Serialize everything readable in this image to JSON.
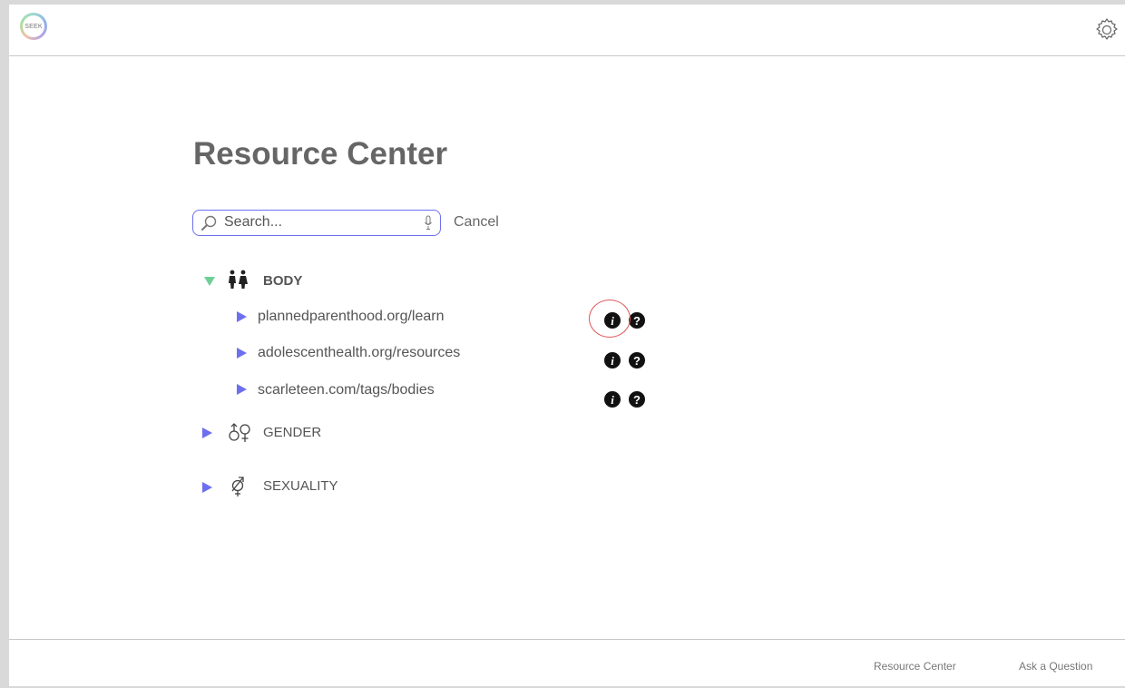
{
  "app": {
    "logo_text": "SEEK"
  },
  "page": {
    "title": "Resource Center"
  },
  "search": {
    "placeholder": "Search...",
    "value": "",
    "cancel_label": "Cancel"
  },
  "categories": [
    {
      "label": "BODY",
      "icon": "people-icon",
      "expanded": true,
      "links": [
        {
          "text": "plannedparenthood.org/learn"
        },
        {
          "text": "adolescenthealth.org/resources"
        },
        {
          "text": "scarleteen.com/tags/bodies"
        }
      ]
    },
    {
      "label": "GENDER",
      "icon": "gender-symbols-icon",
      "expanded": false
    },
    {
      "label": "SEXUALITY",
      "icon": "sexuality-symbol-icon",
      "expanded": false
    }
  ],
  "icons": {
    "info": "i",
    "help": "?"
  },
  "footer": {
    "links": [
      "Resource Center",
      "Ask a Question"
    ]
  },
  "colors": {
    "accent_blue": "#6d6ff0",
    "accent_green": "#6fcf97",
    "highlight_red": "#e05a5a",
    "text_gray": "#666666"
  }
}
